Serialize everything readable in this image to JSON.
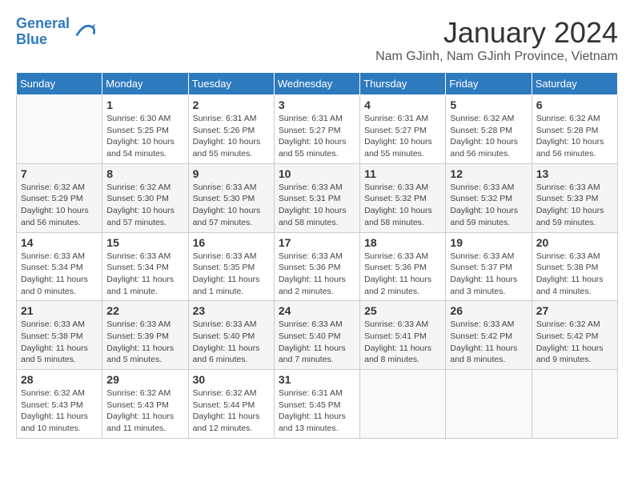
{
  "logo": {
    "line1": "General",
    "line2": "Blue"
  },
  "title": "January 2024",
  "location": "Nam GJinh, Nam GJinh Province, Vietnam",
  "days_of_week": [
    "Sunday",
    "Monday",
    "Tuesday",
    "Wednesday",
    "Thursday",
    "Friday",
    "Saturday"
  ],
  "weeks": [
    [
      {
        "day": "",
        "sunrise": "",
        "sunset": "",
        "daylight": ""
      },
      {
        "day": "1",
        "sunrise": "Sunrise: 6:30 AM",
        "sunset": "Sunset: 5:25 PM",
        "daylight": "Daylight: 10 hours and 54 minutes."
      },
      {
        "day": "2",
        "sunrise": "Sunrise: 6:31 AM",
        "sunset": "Sunset: 5:26 PM",
        "daylight": "Daylight: 10 hours and 55 minutes."
      },
      {
        "day": "3",
        "sunrise": "Sunrise: 6:31 AM",
        "sunset": "Sunset: 5:27 PM",
        "daylight": "Daylight: 10 hours and 55 minutes."
      },
      {
        "day": "4",
        "sunrise": "Sunrise: 6:31 AM",
        "sunset": "Sunset: 5:27 PM",
        "daylight": "Daylight: 10 hours and 55 minutes."
      },
      {
        "day": "5",
        "sunrise": "Sunrise: 6:32 AM",
        "sunset": "Sunset: 5:28 PM",
        "daylight": "Daylight: 10 hours and 56 minutes."
      },
      {
        "day": "6",
        "sunrise": "Sunrise: 6:32 AM",
        "sunset": "Sunset: 5:28 PM",
        "daylight": "Daylight: 10 hours and 56 minutes."
      }
    ],
    [
      {
        "day": "7",
        "sunrise": "Sunrise: 6:32 AM",
        "sunset": "Sunset: 5:29 PM",
        "daylight": "Daylight: 10 hours and 56 minutes."
      },
      {
        "day": "8",
        "sunrise": "Sunrise: 6:32 AM",
        "sunset": "Sunset: 5:30 PM",
        "daylight": "Daylight: 10 hours and 57 minutes."
      },
      {
        "day": "9",
        "sunrise": "Sunrise: 6:33 AM",
        "sunset": "Sunset: 5:30 PM",
        "daylight": "Daylight: 10 hours and 57 minutes."
      },
      {
        "day": "10",
        "sunrise": "Sunrise: 6:33 AM",
        "sunset": "Sunset: 5:31 PM",
        "daylight": "Daylight: 10 hours and 58 minutes."
      },
      {
        "day": "11",
        "sunrise": "Sunrise: 6:33 AM",
        "sunset": "Sunset: 5:32 PM",
        "daylight": "Daylight: 10 hours and 58 minutes."
      },
      {
        "day": "12",
        "sunrise": "Sunrise: 6:33 AM",
        "sunset": "Sunset: 5:32 PM",
        "daylight": "Daylight: 10 hours and 59 minutes."
      },
      {
        "day": "13",
        "sunrise": "Sunrise: 6:33 AM",
        "sunset": "Sunset: 5:33 PM",
        "daylight": "Daylight: 10 hours and 59 minutes."
      }
    ],
    [
      {
        "day": "14",
        "sunrise": "Sunrise: 6:33 AM",
        "sunset": "Sunset: 5:34 PM",
        "daylight": "Daylight: 11 hours and 0 minutes."
      },
      {
        "day": "15",
        "sunrise": "Sunrise: 6:33 AM",
        "sunset": "Sunset: 5:34 PM",
        "daylight": "Daylight: 11 hours and 1 minute."
      },
      {
        "day": "16",
        "sunrise": "Sunrise: 6:33 AM",
        "sunset": "Sunset: 5:35 PM",
        "daylight": "Daylight: 11 hours and 1 minute."
      },
      {
        "day": "17",
        "sunrise": "Sunrise: 6:33 AM",
        "sunset": "Sunset: 5:36 PM",
        "daylight": "Daylight: 11 hours and 2 minutes."
      },
      {
        "day": "18",
        "sunrise": "Sunrise: 6:33 AM",
        "sunset": "Sunset: 5:36 PM",
        "daylight": "Daylight: 11 hours and 2 minutes."
      },
      {
        "day": "19",
        "sunrise": "Sunrise: 6:33 AM",
        "sunset": "Sunset: 5:37 PM",
        "daylight": "Daylight: 11 hours and 3 minutes."
      },
      {
        "day": "20",
        "sunrise": "Sunrise: 6:33 AM",
        "sunset": "Sunset: 5:38 PM",
        "daylight": "Daylight: 11 hours and 4 minutes."
      }
    ],
    [
      {
        "day": "21",
        "sunrise": "Sunrise: 6:33 AM",
        "sunset": "Sunset: 5:38 PM",
        "daylight": "Daylight: 11 hours and 5 minutes."
      },
      {
        "day": "22",
        "sunrise": "Sunrise: 6:33 AM",
        "sunset": "Sunset: 5:39 PM",
        "daylight": "Daylight: 11 hours and 5 minutes."
      },
      {
        "day": "23",
        "sunrise": "Sunrise: 6:33 AM",
        "sunset": "Sunset: 5:40 PM",
        "daylight": "Daylight: 11 hours and 6 minutes."
      },
      {
        "day": "24",
        "sunrise": "Sunrise: 6:33 AM",
        "sunset": "Sunset: 5:40 PM",
        "daylight": "Daylight: 11 hours and 7 minutes."
      },
      {
        "day": "25",
        "sunrise": "Sunrise: 6:33 AM",
        "sunset": "Sunset: 5:41 PM",
        "daylight": "Daylight: 11 hours and 8 minutes."
      },
      {
        "day": "26",
        "sunrise": "Sunrise: 6:33 AM",
        "sunset": "Sunset: 5:42 PM",
        "daylight": "Daylight: 11 hours and 8 minutes."
      },
      {
        "day": "27",
        "sunrise": "Sunrise: 6:32 AM",
        "sunset": "Sunset: 5:42 PM",
        "daylight": "Daylight: 11 hours and 9 minutes."
      }
    ],
    [
      {
        "day": "28",
        "sunrise": "Sunrise: 6:32 AM",
        "sunset": "Sunset: 5:43 PM",
        "daylight": "Daylight: 11 hours and 10 minutes."
      },
      {
        "day": "29",
        "sunrise": "Sunrise: 6:32 AM",
        "sunset": "Sunset: 5:43 PM",
        "daylight": "Daylight: 11 hours and 11 minutes."
      },
      {
        "day": "30",
        "sunrise": "Sunrise: 6:32 AM",
        "sunset": "Sunset: 5:44 PM",
        "daylight": "Daylight: 11 hours and 12 minutes."
      },
      {
        "day": "31",
        "sunrise": "Sunrise: 6:31 AM",
        "sunset": "Sunset: 5:45 PM",
        "daylight": "Daylight: 11 hours and 13 minutes."
      },
      {
        "day": "",
        "sunrise": "",
        "sunset": "",
        "daylight": ""
      },
      {
        "day": "",
        "sunrise": "",
        "sunset": "",
        "daylight": ""
      },
      {
        "day": "",
        "sunrise": "",
        "sunset": "",
        "daylight": ""
      }
    ]
  ]
}
